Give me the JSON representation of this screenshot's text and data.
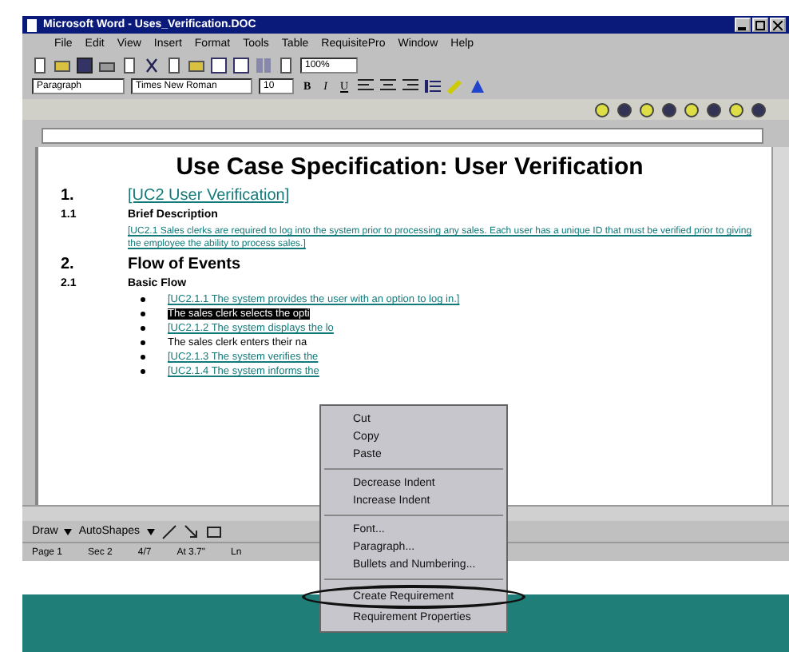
{
  "window": {
    "title": "Microsoft Word - Uses_Verification.DOC"
  },
  "menu_bar": [
    "File",
    "Edit",
    "View",
    "Insert",
    "Format",
    "Tools",
    "Table",
    "RequisitePro",
    "Window",
    "Help"
  ],
  "standard_toolbar": {
    "zoom": "100%"
  },
  "formatting_toolbar": {
    "style": "Paragraph",
    "font": "Times New Roman",
    "size": "10",
    "buttons": [
      "B",
      "I",
      "U"
    ]
  },
  "document": {
    "title": "Use Case Specification: User Verification",
    "blocks": [
      {
        "kind": "h1",
        "number": "1.",
        "text": "[UC2 User Verification]",
        "link": true
      },
      {
        "kind": "h2",
        "number": "1.1",
        "text": "Brief Description",
        "link": false
      },
      {
        "kind": "para",
        "text": "[UC2.1 Sales clerks are required to log into the system prior to processing any sales. Each user has a unique ID that must be verified prior to giving the employee the ability to process sales.]",
        "link": true
      },
      {
        "kind": "h1",
        "number": "2.",
        "text": "Flow of Events",
        "link": false
      },
      {
        "kind": "h2",
        "number": "2.1",
        "text": "Basic Flow",
        "link": false
      },
      {
        "kind": "bullet",
        "text": "[UC2.1.1 The system provides the user with an option to log in.]",
        "link": true,
        "selected": false
      },
      {
        "kind": "bullet",
        "text": "The sales clerk selects the opti",
        "link": false,
        "selected": true
      },
      {
        "kind": "bullet",
        "text": "[UC2.1.2 The system displays the lo",
        "link": true,
        "selected": false
      },
      {
        "kind": "bullet",
        "text": "The sales clerk enters their na",
        "link": false,
        "selected": false
      },
      {
        "kind": "bullet",
        "text": "[UC2.1.3 The system verifies the",
        "link": true,
        "selected": false
      },
      {
        "kind": "bullet",
        "text": "[UC2.1.4 The system informs the",
        "link": true,
        "selected": false
      }
    ]
  },
  "drawing_toolbar": [
    "Draw",
    "AutoShapes"
  ],
  "status_bar": [
    "Page 1",
    "Sec 2",
    "4/7",
    "At 3.7\"",
    "Ln"
  ],
  "context_menu": {
    "groups": [
      [
        {
          "label": "Cut",
          "circled": false
        },
        {
          "label": "Copy",
          "circled": false
        },
        {
          "label": "Paste",
          "circled": false
        }
      ],
      [
        {
          "label": "Decrease Indent",
          "circled": false
        },
        {
          "label": "Increase Indent",
          "circled": false
        }
      ],
      [
        {
          "label": "Font...",
          "circled": false
        },
        {
          "label": "Paragraph...",
          "circled": false
        },
        {
          "label": "Bullets and Numbering...",
          "circled": false
        }
      ],
      [
        {
          "label": "Create Requirement",
          "circled": true
        },
        {
          "label": "Requirement Properties",
          "circled": false
        }
      ]
    ]
  }
}
